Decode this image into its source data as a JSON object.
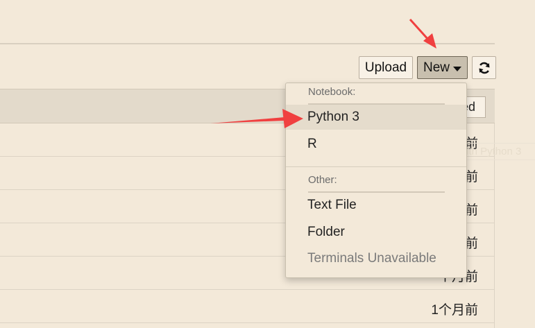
{
  "toolbar": {
    "upload_label": "Upload",
    "new_label": "New",
    "refresh_icon": "refresh-icon"
  },
  "list_header": {
    "button_label": "ed"
  },
  "rows": [
    {
      "time": "前"
    },
    {
      "time": "前"
    },
    {
      "time": "前"
    },
    {
      "time": "前"
    },
    {
      "time": "个月前"
    },
    {
      "time": "1个月前"
    }
  ],
  "tooltip": "Create a new notebook with Python 3",
  "menu": {
    "notebook_header": "Notebook:",
    "notebook_items": [
      "Python 3",
      "R"
    ],
    "other_header": "Other:",
    "other_items": [
      "Text File",
      "Folder"
    ],
    "disabled_item": "Terminals Unavailable"
  },
  "annotation_color": "#f04040"
}
